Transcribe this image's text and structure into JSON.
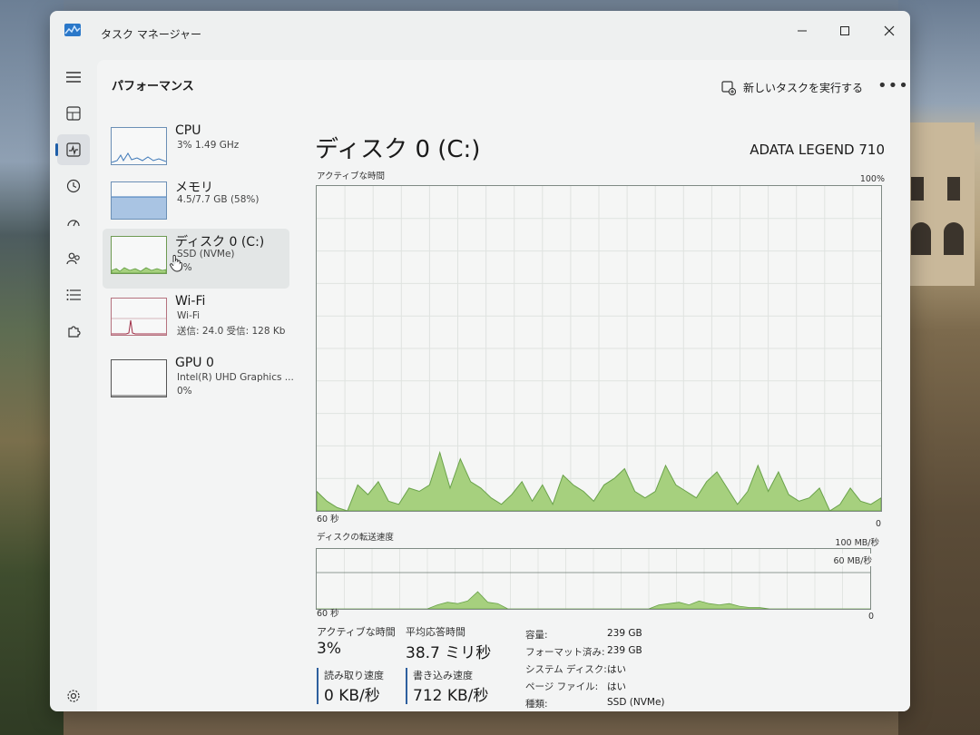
{
  "window": {
    "title": "タスク マネージャー"
  },
  "header": {
    "title": "パフォーマンス",
    "run_task": "新しいタスクを実行する",
    "more": "•••"
  },
  "perf_items": [
    {
      "name": "CPU",
      "sub": "3%  1.49 GHz"
    },
    {
      "name": "メモリ",
      "sub": "4.5/7.7 GB (58%)"
    },
    {
      "name": "ディスク 0 (C:)",
      "sub": "SSD (NVMe)",
      "sub2": "0%"
    },
    {
      "name": "Wi-Fi",
      "sub": "Wi-Fi",
      "sub2": "送信: 24.0  受信: 128 Kb"
    },
    {
      "name": "GPU 0",
      "sub": "Intel(R) UHD Graphics ...",
      "sub2": "0%"
    }
  ],
  "detail": {
    "title": "ディスク 0 (C:)",
    "model": "ADATA LEGEND 710",
    "active_label": "アクティブな時間",
    "active_max": "100%",
    "time_left": "60 秒",
    "time_right": "0",
    "transfer_label": "ディスクの転送速度",
    "transfer_max": "100 MB/秒",
    "transfer_mid": "60 MB/秒",
    "time_left2": "60 秒",
    "time_right2": "0"
  },
  "stats": {
    "active_time_label": "アクティブな時間",
    "active_time": "3%",
    "avg_response_label": "平均応答時間",
    "avg_response": "38.7 ミリ秒",
    "read_label": "読み取り速度",
    "read": "0 KB/秒",
    "write_label": "書き込み速度",
    "write": "712 KB/秒"
  },
  "props": [
    {
      "k": "容量:",
      "v": "239 GB"
    },
    {
      "k": "フォーマット済み:",
      "v": "239 GB"
    },
    {
      "k": "システム ディスク:",
      "v": "はい"
    },
    {
      "k": "ページ ファイル:",
      "v": "はい"
    },
    {
      "k": "種類:",
      "v": "SSD (NVMe)"
    }
  ],
  "chart_data": {
    "type": "area",
    "title": "アクティブな時間",
    "ylim": [
      0,
      100
    ],
    "x_range": [
      "60 秒",
      "0"
    ],
    "values": [
      6,
      3,
      1,
      0,
      8,
      5,
      9,
      3,
      2,
      7,
      6,
      8,
      18,
      7,
      16,
      9,
      7,
      4,
      2,
      5,
      9,
      3,
      8,
      2,
      11,
      8,
      6,
      3,
      8,
      10,
      13,
      6,
      4,
      6,
      14,
      8,
      6,
      4,
      9,
      12,
      7,
      2,
      6,
      14,
      6,
      12,
      5,
      3,
      4,
      7,
      0,
      2,
      7,
      3,
      2,
      4
    ],
    "color": "#a6d07e"
  }
}
